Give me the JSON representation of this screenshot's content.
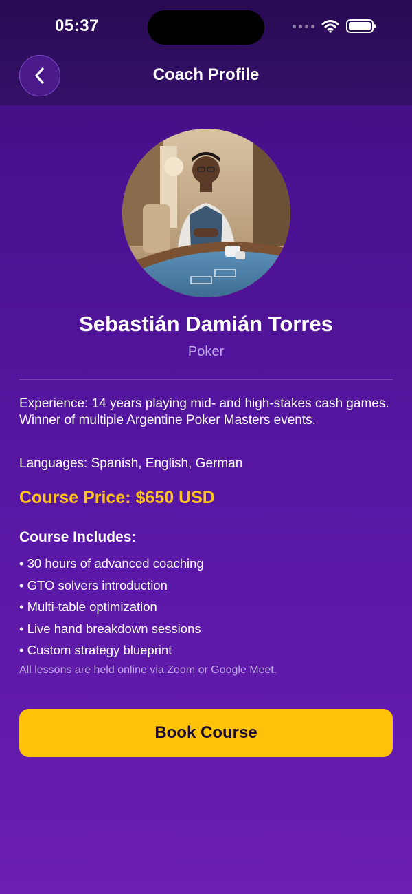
{
  "status_bar": {
    "time": "05:37"
  },
  "header": {
    "title": "Coach Profile"
  },
  "icons": {
    "back": "chevron-left-icon",
    "wifi": "wifi-icon",
    "battery": "battery-icon",
    "signal": "cellular-dots-icon"
  },
  "coach": {
    "name": "Sebastián Damián Torres",
    "sport": "Poker",
    "experience": "Experience: 14 years playing mid- and high-stakes cash games. Winner of multiple Argentine Poker Masters events.",
    "languages": "Languages: Spanish, English, German"
  },
  "course": {
    "price_label": "Course Price: $650 USD",
    "includes_title": "Course Includes:",
    "includes": [
      "• 30 hours of advanced coaching",
      "• GTO solvers introduction",
      "• Multi-table optimization",
      "• Live hand breakdown sessions",
      "• Custom strategy blueprint"
    ],
    "note": "All lessons are held online via Zoom or Google Meet."
  },
  "actions": {
    "book_label": "Book Course"
  },
  "colors": {
    "accent": "#ffc209",
    "background_top": "#3d0d74",
    "background_bottom": "#6a1eb2",
    "muted_text": "#c1a8e6"
  }
}
